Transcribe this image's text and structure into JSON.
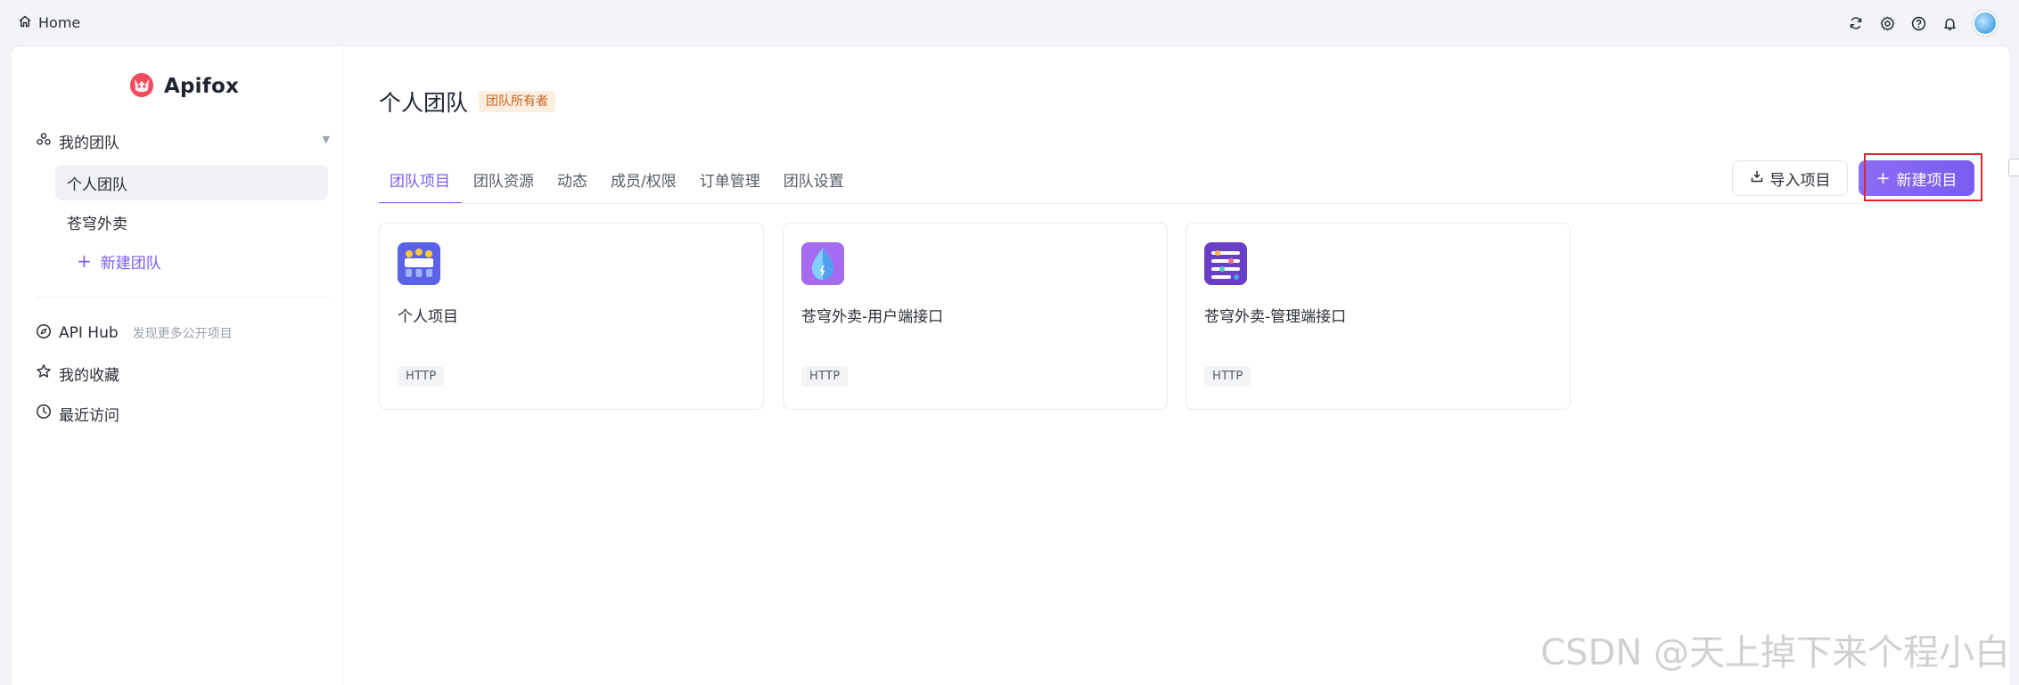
{
  "topbar": {
    "home_label": "Home",
    "icons": [
      "refresh-icon",
      "settings-icon",
      "help-icon",
      "bell-icon"
    ]
  },
  "sidebar": {
    "logo_text": "Apifox",
    "team_header": "我的团队",
    "teams": [
      {
        "label": "个人团队",
        "active": true
      },
      {
        "label": "苍穹外卖",
        "active": false
      }
    ],
    "new_team": "新建团队",
    "nav": [
      {
        "label": "API Hub",
        "sub": "发现更多公开项目",
        "icon": "compass-icon"
      },
      {
        "label": "我的收藏",
        "sub": "",
        "icon": "star-icon"
      },
      {
        "label": "最近访问",
        "sub": "",
        "icon": "clock-icon"
      }
    ]
  },
  "main": {
    "team_name": "个人团队",
    "owner_badge": "团队所有者",
    "tabs": [
      {
        "label": "团队项目",
        "active": true
      },
      {
        "label": "团队资源",
        "active": false
      },
      {
        "label": "动态",
        "active": false
      },
      {
        "label": "成员/权限",
        "active": false
      },
      {
        "label": "订单管理",
        "active": false
      },
      {
        "label": "团队设置",
        "active": false
      }
    ],
    "import_label": "导入项目",
    "new_project_label": "新建项目",
    "projects": [
      {
        "name": "个人项目",
        "tag": "HTTP",
        "icon": "team-project-icon"
      },
      {
        "name": "苍穹外卖-用户端接口",
        "tag": "HTTP",
        "icon": "water-drop-icon"
      },
      {
        "name": "苍穹外卖-管理端接口",
        "tag": "HTTP",
        "icon": "list-settings-icon"
      }
    ]
  },
  "watermark": "CSDN @天上掉下来个程小白",
  "colors": {
    "accent": "#7c5cf2",
    "badge_text": "#c7641e",
    "badge_bg": "#fdeedf",
    "highlight": "#e0242b"
  }
}
